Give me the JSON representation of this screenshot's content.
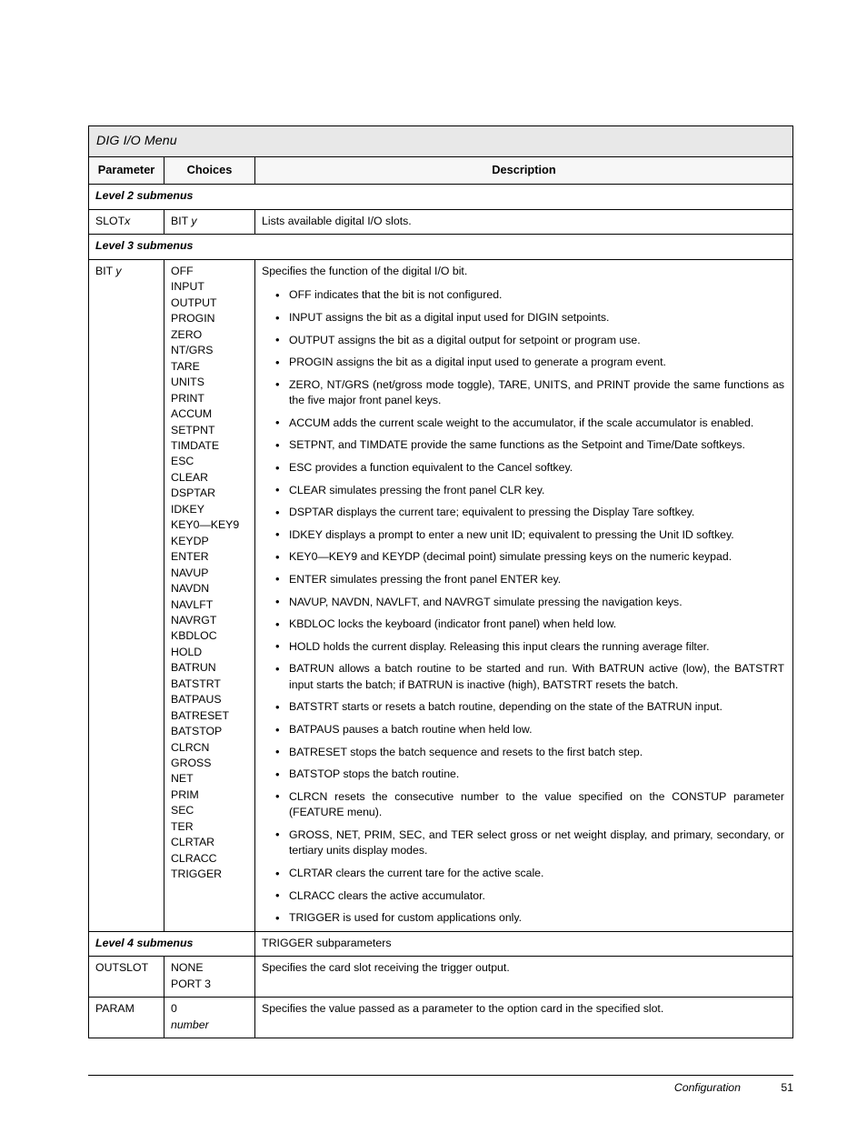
{
  "table": {
    "title": "DIG I/O Menu",
    "headers": {
      "parameter": "Parameter",
      "choices": "Choices",
      "description": "Description"
    },
    "level2": {
      "label": "Level 2 submenus",
      "row": {
        "parameter_base": "SLOT",
        "parameter_var": "x",
        "choices_base": "BIT ",
        "choices_var": "y",
        "description": "Lists available digital I/O slots."
      }
    },
    "level3": {
      "label": "Level 3 submenus",
      "row": {
        "parameter_base": "BIT ",
        "parameter_var": "y",
        "choices": "OFF\nINPUT\nOUTPUT\nPROGIN\nZERO\nNT/GRS\nTARE\nUNITS\nPRINT\nACCUM\nSETPNT\nTIMDATE\nESC\nCLEAR\nDSPTAR\nIDKEY\nKEY0—KEY9\nKEYDP\nENTER\nNAVUP\nNAVDN\nNAVLFT\nNAVRGT\nKBDLOC\nHOLD\nBATRUN\nBATSTRT\nBATPAUS\nBATRESET\nBATSTOP\nCLRCN\nGROSS\nNET\nPRIM\nSEC\nTER\nCLRTAR\nCLRACC\nTRIGGER",
        "description_intro": "Specifies the function of the digital I/O bit.",
        "bullets": [
          "OFF indicates that the bit is not configured.",
          "INPUT assigns the bit as a digital input used for DIGIN setpoints.",
          "OUTPUT assigns the bit as a digital output for setpoint or program use.",
          "PROGIN assigns the bit as a digital input used to generate a program event.",
          "ZERO, NT/GRS (net/gross mode toggle), TARE, UNITS, and PRINT provide the same functions as the five major front panel keys.",
          "ACCUM adds the current scale weight to the accumulator, if the scale accumulator is enabled.",
          "SETPNT, and TIMDATE provide the same functions as the Setpoint and Time/Date softkeys.",
          "ESC provides a function equivalent to the Cancel softkey.",
          "CLEAR simulates pressing the front panel CLR key.",
          "DSPTAR displays the current tare; equivalent to pressing the Display Tare softkey.",
          "IDKEY displays a prompt to enter a new unit ID; equivalent to pressing the Unit ID softkey.",
          "KEY0—KEY9 and KEYDP (decimal point) simulate pressing keys on the numeric keypad.",
          "ENTER simulates pressing the front panel ENTER key.",
          "NAVUP, NAVDN, NAVLFT, and NAVRGT simulate pressing the navigation keys.",
          "KBDLOC locks the keyboard (indicator front panel) when held low.",
          "HOLD holds the current display. Releasing this input clears the running average filter.",
          "BATRUN allows a batch routine to be started and run. With BATRUN active (low), the BATSTRT input starts the batch; if BATRUN is inactive (high), BATSTRT resets the batch.",
          "BATSTRT starts or resets a batch routine, depending on the state of the BATRUN input.",
          "BATPAUS pauses a batch routine when held low.",
          "BATRESET stops the batch sequence and resets to the first batch step.",
          "BATSTOP stops the batch routine.",
          "CLRCN resets the consecutive number to the value specified on the CONSTUP parameter (FEATURE menu).",
          "GROSS, NET, PRIM, SEC, and TER select gross or net weight display, and primary, secondary, or tertiary units display modes.",
          "CLRTAR clears the current tare for the active scale.",
          "CLRACC clears the active accumulator.",
          "TRIGGER is used for custom applications only."
        ]
      }
    },
    "level4": {
      "label": "Level 4 submenus",
      "description": "TRIGGER subparameters",
      "rows": [
        {
          "parameter": "OUTSLOT",
          "choices": "NONE\nPORT 3",
          "description": "Specifies the card slot receiving the trigger output."
        },
        {
          "parameter": "PARAM",
          "choices_plain": "0",
          "choices_italic": "number",
          "description": "Specifies the value passed as a parameter to the option card in the specified slot."
        }
      ]
    }
  },
  "footer": {
    "chapter": "Configuration",
    "page_number": "51"
  },
  "colors": {
    "title_band": "#e8e8e8",
    "header_band": "#f7f7f7",
    "border": "#000000",
    "text": "#000000"
  }
}
